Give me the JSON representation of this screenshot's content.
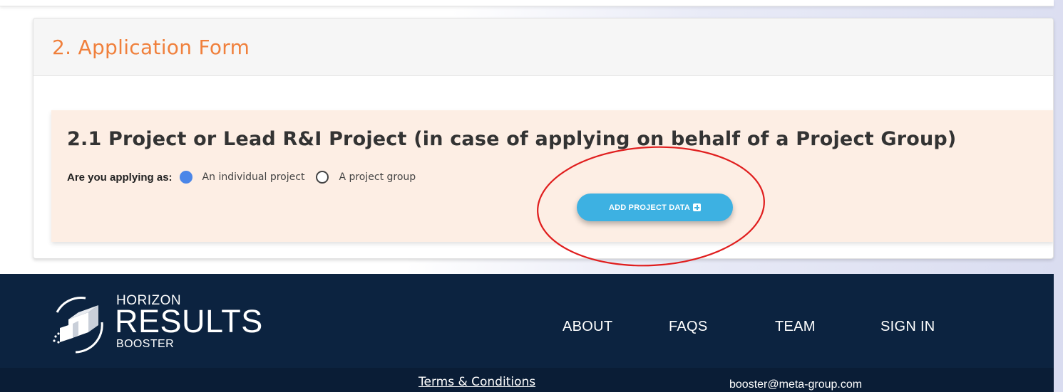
{
  "form": {
    "title": "2. Application Form",
    "section": {
      "title": "2.1 Project or Lead R&I Project (in case of applying on behalf of a Project Group)",
      "question_label": "Are you applying as:",
      "options": [
        {
          "label": "An individual project",
          "checked": true
        },
        {
          "label": "A project group",
          "checked": false
        }
      ],
      "add_button_label": "ADD PROJECT DATA"
    }
  },
  "footer": {
    "logo": {
      "line1": "HORIZON",
      "line2": "RESULTS",
      "line3": "BOOSTER"
    },
    "nav": [
      "ABOUT",
      "FAQS",
      "TEAM",
      "SIGN IN"
    ],
    "terms_label": "Terms & Conditions",
    "email": "booster@meta-group.com"
  },
  "colors": {
    "accent_orange": "#f0803c",
    "section_bg": "#fdeee4",
    "button_blue": "#3db1e2",
    "radio_blue": "#4b86e8",
    "footer_navy": "#0c2340",
    "annotation_red": "#e01e1e"
  },
  "icons": {
    "add_button": "plus-square-icon",
    "logo_mark": "results-booster-logo-icon"
  }
}
